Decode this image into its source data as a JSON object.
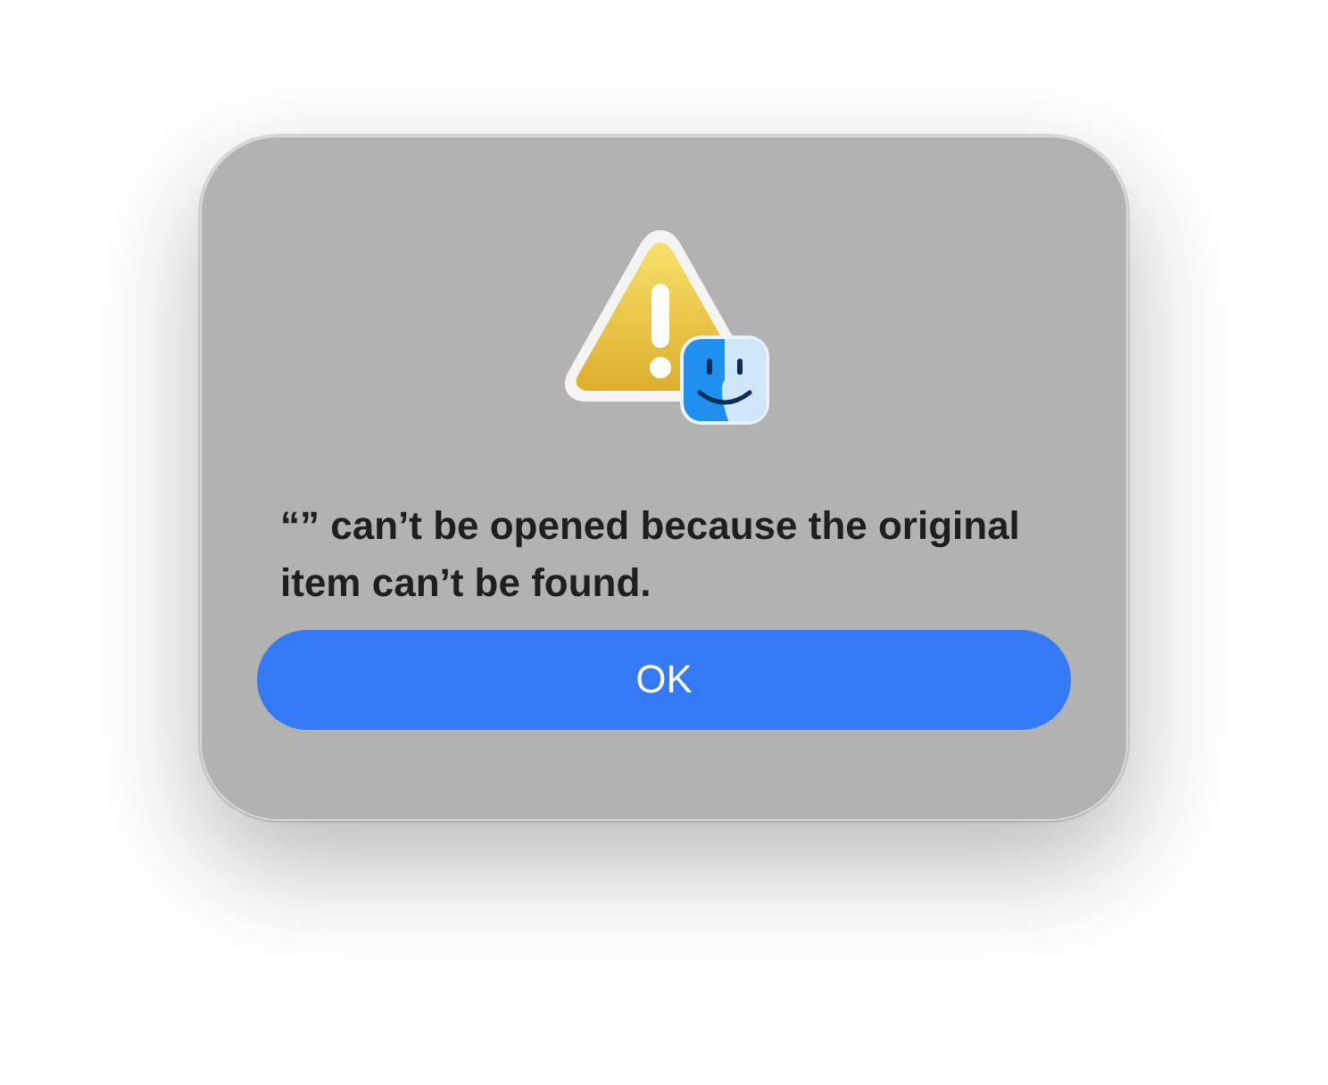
{
  "dialog": {
    "message": "“” can’t be opened because the original item can’t be found.",
    "buttons": [
      {
        "label": "OK",
        "default": true
      }
    ]
  }
}
